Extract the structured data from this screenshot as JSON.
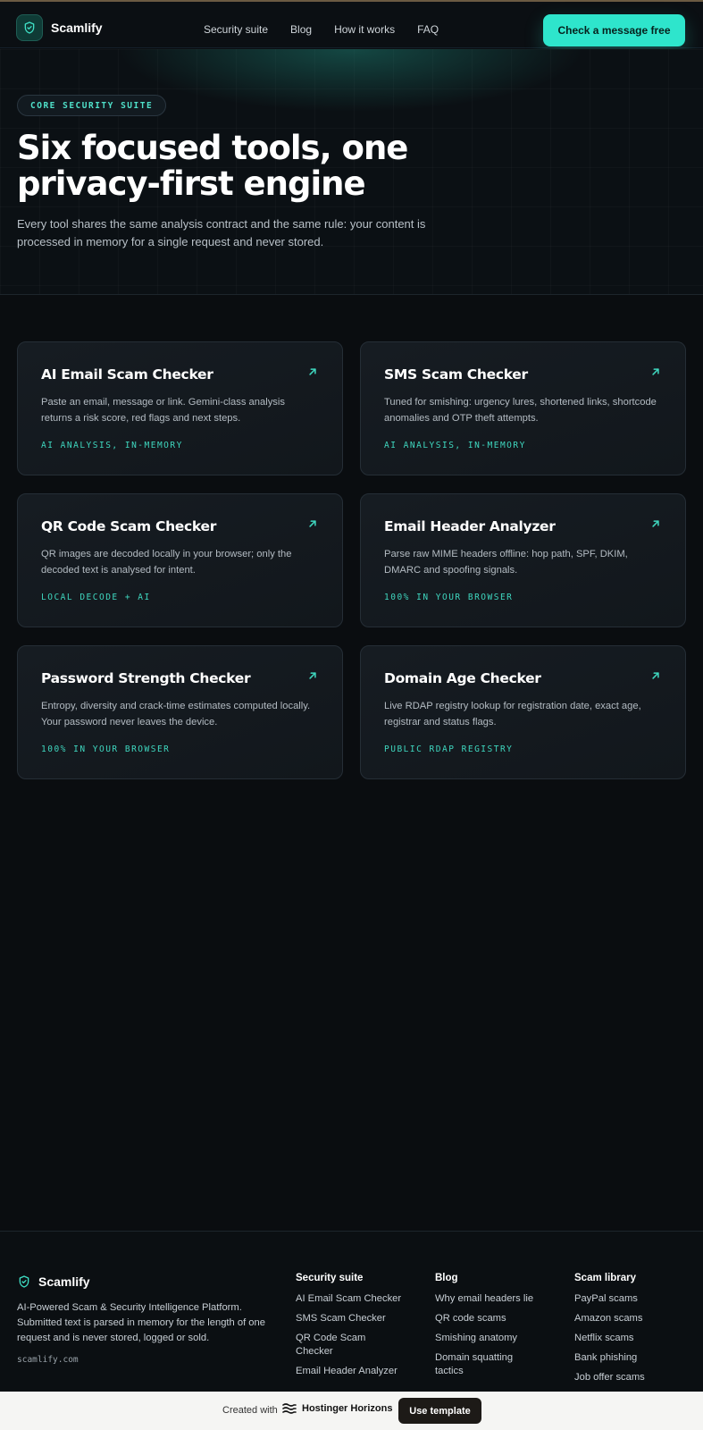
{
  "brand": {
    "name": "Scamlify",
    "accent": "#2ee5cc"
  },
  "nav": {
    "items": [
      {
        "label": "Security suite"
      },
      {
        "label": "Blog"
      },
      {
        "label": "How it works"
      },
      {
        "label": "FAQ"
      }
    ],
    "cta_label": "Check a message free"
  },
  "hero": {
    "eyebrow": "CORE SECURITY SUITE",
    "title": "Six focused tools, one privacy-first engine",
    "subtitle": "Every tool shares the same analysis contract and the same rule: your content is processed in memory for a single request and never stored."
  },
  "tools": [
    {
      "title": "AI Email Scam Checker",
      "desc": "Paste an email, message or link. Gemini-class analysis returns a risk score, red flags and next steps.",
      "tag": "AI ANALYSIS, IN-MEMORY",
      "icon": "arrow-up-right-icon"
    },
    {
      "title": "SMS Scam Checker",
      "desc": "Tuned for smishing: urgency lures, shortened links, shortcode anomalies and OTP theft attempts.",
      "tag": "AI ANALYSIS, IN-MEMORY",
      "icon": "arrow-up-right-icon"
    },
    {
      "title": "QR Code Scam Checker",
      "desc": "QR images are decoded locally in your browser; only the decoded text is analysed for intent.",
      "tag": "LOCAL DECODE + AI",
      "icon": "arrow-up-right-icon"
    },
    {
      "title": "Email Header Analyzer",
      "desc": "Parse raw MIME headers offline: hop path, SPF, DKIM, DMARC and spoofing signals.",
      "tag": "100% IN YOUR BROWSER",
      "icon": "arrow-up-right-icon"
    },
    {
      "title": "Password Strength Checker",
      "desc": "Entropy, diversity and crack-time estimates computed locally. Your password never leaves the device.",
      "tag": "100% IN YOUR BROWSER",
      "icon": "arrow-up-right-icon"
    },
    {
      "title": "Domain Age Checker",
      "desc": "Live RDAP registry lookup for registration date, exact age, registrar and status flags.",
      "tag": "PUBLIC RDAP REGISTRY",
      "icon": "arrow-up-right-icon"
    }
  ],
  "footer": {
    "brand": "Scamlify",
    "description": "AI-Powered Scam & Security Intelligence Platform. Submitted text is parsed in memory for the length of one request and is never stored, logged or sold.",
    "domain": "scamlify.com",
    "columns": [
      {
        "heading": "Security suite",
        "links": [
          "AI Email Scam Checker",
          "SMS Scam Checker",
          "QR Code Scam Checker",
          "Email Header Analyzer"
        ]
      },
      {
        "heading": "Blog",
        "links": [
          "Why email headers lie",
          "QR code scams",
          "Smishing anatomy",
          "Domain squatting tactics"
        ]
      },
      {
        "heading": "Scam library",
        "links": [
          "PayPal scams",
          "Amazon scams",
          "Netflix scams",
          "Bank phishing",
          "Job offer scams"
        ]
      }
    ]
  },
  "bottom_bar": {
    "created_with": "Created with",
    "platform": "Hostinger Horizons",
    "button_label": "Use template"
  }
}
